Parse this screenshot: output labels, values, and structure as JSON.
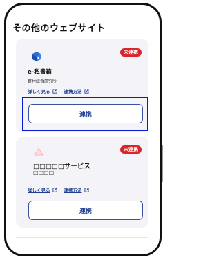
{
  "page": {
    "heading": "その他のウェブサイト"
  },
  "services": [
    {
      "name": "e-私書箱",
      "provider": "野村総合研究所",
      "status_badge": "未連携",
      "link_details": "詳しく見る",
      "link_howto": "連携方法",
      "connect_label": "連携",
      "icon": "app-logo-icon"
    },
    {
      "name": "□□□□□サービス",
      "provider": "□□□□",
      "status_badge": "未連携",
      "link_details": "詳しく見る",
      "link_howto": "連携方法",
      "connect_label": "連携",
      "icon": "warning-triangle-icon"
    }
  ],
  "colors": {
    "accent": "#1f3f8f",
    "badge": "#d7262b",
    "focus": "#0a1bd6",
    "card": "#f4f4f8"
  }
}
